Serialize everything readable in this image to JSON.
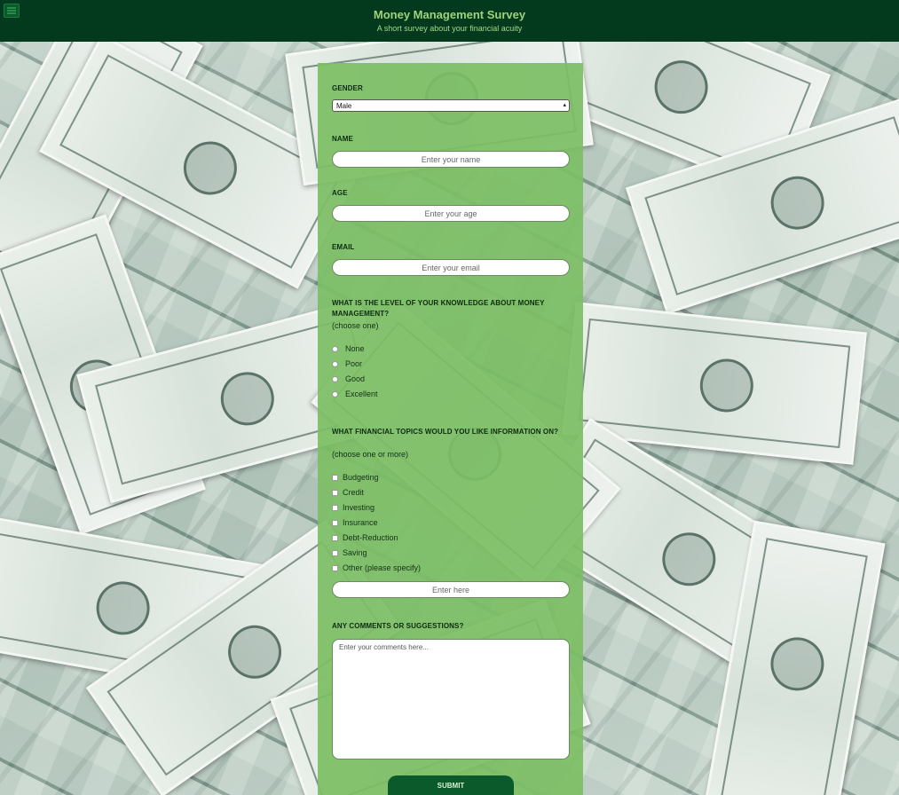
{
  "header": {
    "title": "Money Management Survey",
    "subtitle": "A short survey about your financial acuity"
  },
  "form": {
    "gender": {
      "label": "Gender",
      "selected": "Male"
    },
    "name": {
      "label": "Name",
      "placeholder": "Enter your name"
    },
    "age": {
      "label": "Age",
      "placeholder": "Enter your age"
    },
    "email": {
      "label": "Email",
      "placeholder": "Enter your email"
    },
    "knowledge": {
      "question": "What is the level of your knowledge about money management?",
      "hint": "(choose one)",
      "options": [
        "None",
        "Poor",
        "Good",
        "Excellent"
      ]
    },
    "topics": {
      "question": "What financial topics would you like information on?",
      "hint": "(choose one or more)",
      "options": [
        "Budgeting",
        "Credit",
        "Investing",
        "Insurance",
        "Debt-Reduction",
        "Saving",
        "Other (please specify)"
      ],
      "other_placeholder": "Enter here"
    },
    "comments": {
      "label": "Any comments or suggestions?",
      "placeholder": "Enter your comments here..."
    },
    "submit_label": "Submit"
  },
  "colors": {
    "header_bg": "#033a1d",
    "title_color": "#9fd27a",
    "panel_bg": "#7cbe64",
    "submit_bg": "#0a5a2c"
  },
  "icons": {
    "menu": "hamburger-menu-icon",
    "select_arrow": "updown-arrows-icon"
  }
}
